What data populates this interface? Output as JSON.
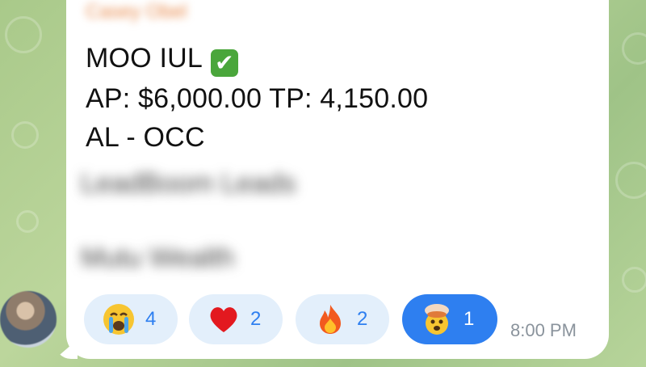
{
  "message": {
    "sender": "Casey Obel",
    "line1": "MOO IUL",
    "check_glyph": "✔",
    "line2": "AP: $6,000.00 TP: 4,150.00",
    "line3": "AL - OCC",
    "blurred_line1": "LeadBoom Leads",
    "blurred_line2": "Mutu Wealth",
    "time": "8:00 PM"
  },
  "reactions": [
    {
      "icon": "crying-face-icon",
      "count": "4",
      "active": false
    },
    {
      "icon": "red-heart-icon",
      "count": "2",
      "active": false
    },
    {
      "icon": "fire-icon",
      "count": "2",
      "active": false
    },
    {
      "icon": "exploding-head-icon",
      "count": "1",
      "active": true
    }
  ],
  "colors": {
    "bubble": "#ffffff",
    "accent": "#2e7ff0",
    "reaction_bg": "#e3effb",
    "background": "#a9c98a",
    "check": "#4aa63b"
  }
}
